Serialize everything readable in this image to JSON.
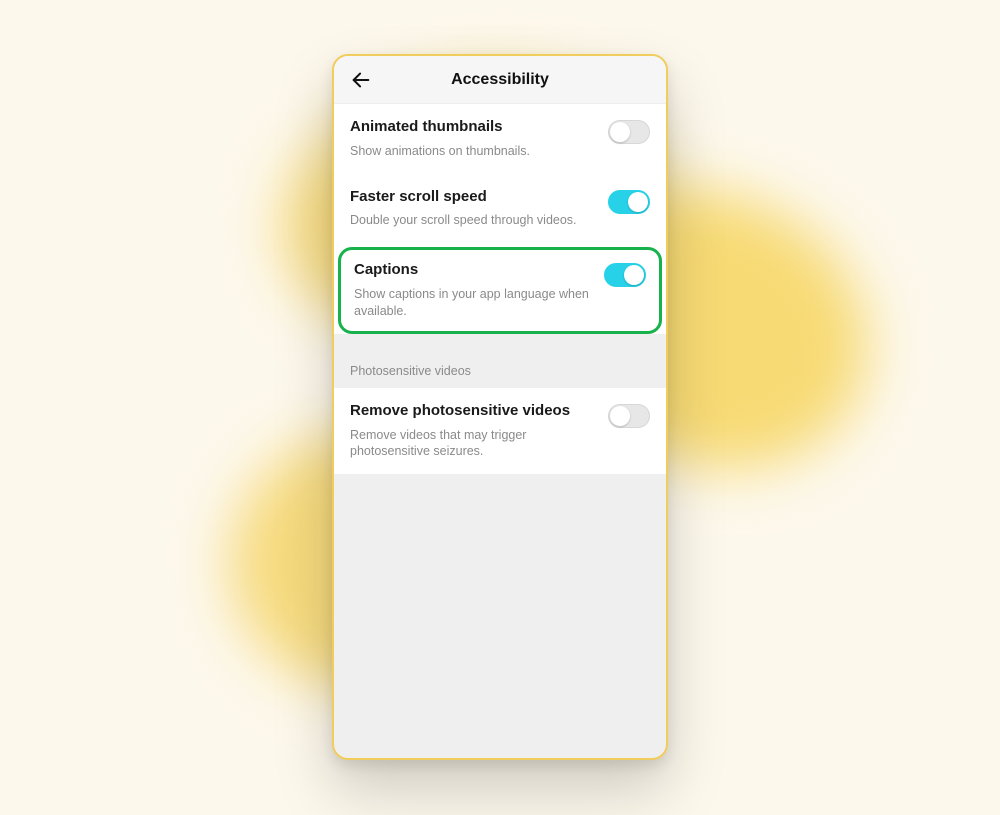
{
  "header": {
    "title": "Accessibility"
  },
  "section1": {
    "animated_thumbnails": {
      "label": "Animated thumbnails",
      "desc": "Show animations on thumbnails.",
      "on": false
    },
    "faster_scroll": {
      "label": "Faster scroll speed",
      "desc": "Double your scroll speed through videos.",
      "on": true
    },
    "captions": {
      "label": "Captions",
      "desc": "Show captions in your app language when available.",
      "on": true,
      "highlighted": true
    }
  },
  "section2": {
    "title": "Photosensitive videos",
    "remove_photosensitive": {
      "label": "Remove photosensitive videos",
      "desc": "Remove videos that may trigger photosensitive seizures.",
      "on": false
    }
  },
  "colors": {
    "accent_toggle_on": "#27d2e8",
    "highlight_border": "#17b24b",
    "phone_border": "#f0cd5d",
    "page_bg": "#fdf8ec",
    "blob": "#f6da7d"
  }
}
